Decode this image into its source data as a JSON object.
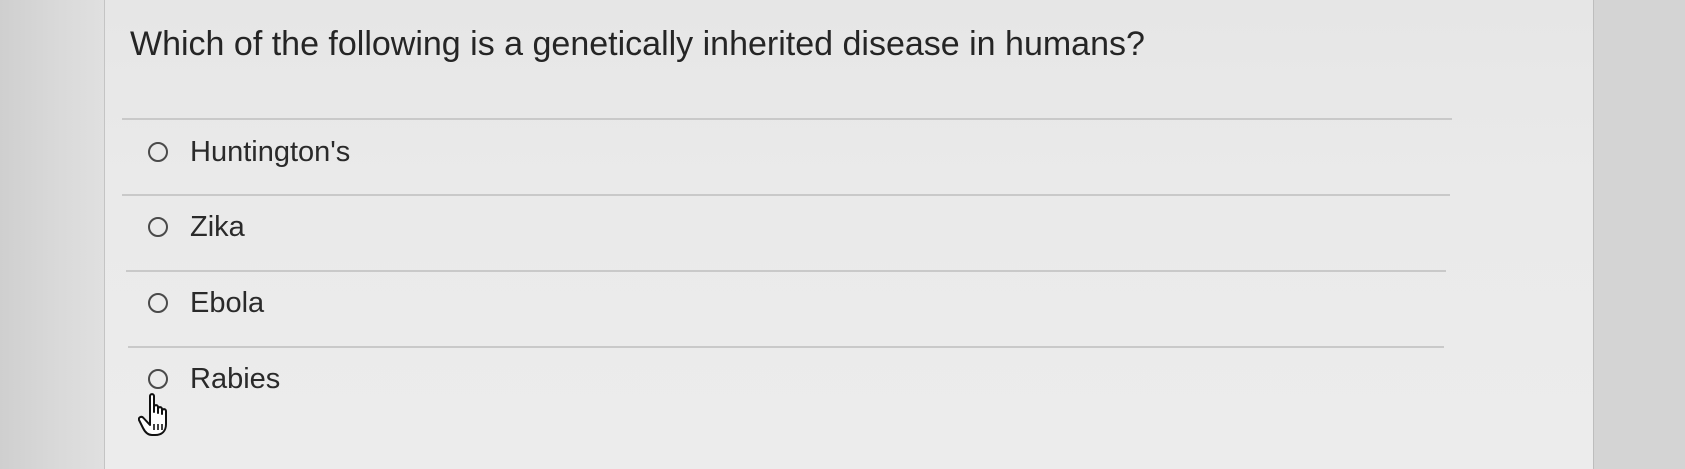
{
  "question": {
    "text": "Which of the following is a genetically inherited disease in humans?"
  },
  "options": [
    {
      "label": "Huntington's",
      "selected": false
    },
    {
      "label": "Zika",
      "selected": false
    },
    {
      "label": "Ebola",
      "selected": false
    },
    {
      "label": "Rabies",
      "selected": false
    }
  ],
  "cursor": {
    "icon": "hand-pointer-icon"
  }
}
